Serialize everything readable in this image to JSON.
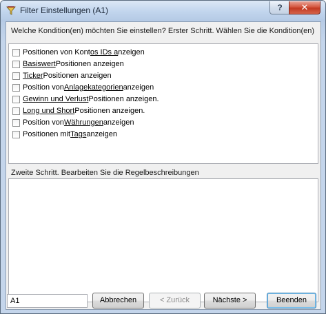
{
  "window": {
    "title": "Filter Einstellungen (A1)",
    "help_label": "?",
    "close_label": "✕"
  },
  "step1": {
    "instruction": "Welche Kondition(en) möchten Sie einstellen? Erster Schritt. Wählen Sie die Kondition(en)",
    "conditions": [
      {
        "pre": "Positionen von Kont",
        "link": "os IDs a",
        "post": "nzeigen",
        "checked": false
      },
      {
        "pre": "",
        "link": "Basiswert",
        "post": " Positionen anzeigen",
        "checked": false
      },
      {
        "pre": "",
        "link": "Ticker",
        "post": " Positionen anzeigen",
        "checked": false
      },
      {
        "pre": "Position von ",
        "link": "Anlagekategorien",
        "post": " anzeigen",
        "checked": false
      },
      {
        "pre": "",
        "link": "Gewinn und Verlust",
        "post": " Positionen anzeigen.",
        "checked": false
      },
      {
        "pre": "",
        "link": "Long und Short",
        "post": " Positionen anzeigen.",
        "checked": false
      },
      {
        "pre": "Position von ",
        "link": "Währungen",
        "post": " anzeigen",
        "checked": false
      },
      {
        "pre": "Positionen mit ",
        "link": "Tags",
        "post": " anzeigen",
        "checked": false
      }
    ]
  },
  "step2": {
    "label": "Zweite Schritt. Bearbeiten Sie die Regelbeschreibungen"
  },
  "footer": {
    "name_value": "A1",
    "cancel_label": "Abbrechen",
    "back_label": "< Zurück",
    "next_label": "Nächste >",
    "finish_label": "Beenden"
  }
}
